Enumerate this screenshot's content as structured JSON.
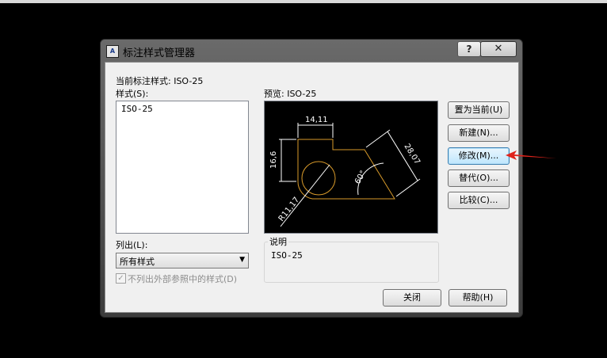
{
  "dialog": {
    "title": "标注样式管理器",
    "app_icon_text": "A",
    "help_button": "?",
    "close_button": "✕",
    "current_style_label": "当前标注样式: ISO-25",
    "styles_label": "样式(S):",
    "styles": [
      "ISO-25"
    ],
    "preview_label": "预览: ISO-25",
    "list_label": "列出(L):",
    "list_selected": "所有样式",
    "exclude_xref_label": "不列出外部参照中的样式(D)",
    "exclude_xref_checked": true,
    "description_label": "说明",
    "description_text": "ISO-25",
    "buttons": {
      "set_current": "置为当前(U)",
      "new": "新建(N)...",
      "modify": "修改(M)...",
      "override": "替代(O)...",
      "compare": "比较(C)...",
      "close": "关闭",
      "help": "帮助(H)"
    }
  },
  "preview_dims": {
    "top": "14,11",
    "left": "16,6",
    "slant": "28,07",
    "angle": "60°",
    "radius": "R11,17"
  },
  "colors": {
    "geometry": "#d89a2a",
    "dims": "#ffffff",
    "annotation_arrow": "#e0231b"
  }
}
